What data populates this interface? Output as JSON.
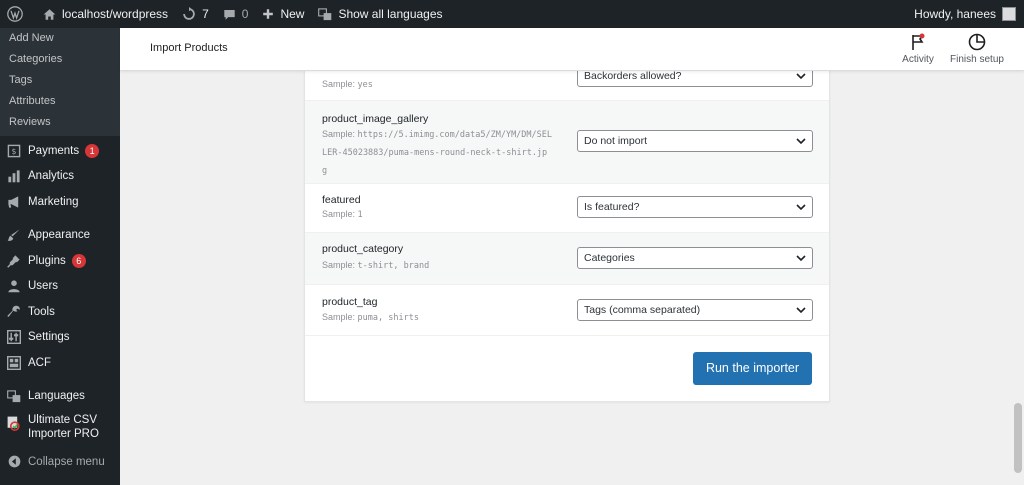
{
  "adminbar": {
    "site": "localhost/wordpress",
    "updates": "7",
    "comments": "0",
    "new": "New",
    "languages": "Show all languages",
    "howdy": "Howdy, hanees"
  },
  "sidebar": {
    "submenu": [
      "Add New",
      "Categories",
      "Tags",
      "Attributes",
      "Reviews"
    ],
    "payments": "Payments",
    "payments_badge": "1",
    "analytics": "Analytics",
    "marketing": "Marketing",
    "appearance": "Appearance",
    "plugins": "Plugins",
    "plugins_badge": "6",
    "users": "Users",
    "tools": "Tools",
    "settings": "Settings",
    "acf": "ACF",
    "languages": "Languages",
    "csv_line1": "Ultimate CSV",
    "csv_line2": "Importer PRO",
    "collapse": "Collapse menu"
  },
  "header": {
    "title": "Import Products",
    "activity": "Activity",
    "finish_setup": "Finish setup"
  },
  "rows": [
    {
      "field": "",
      "sample_label": "Sample:",
      "sample": "yes",
      "select": "Backorders allowed?"
    },
    {
      "field": "product_image_gallery",
      "sample_label": "Sample:",
      "sample": "https://5.imimg.com/data5/ZM/YM/DM/SELLER-45023883/puma-mens-round-neck-t-shirt.jpg",
      "select": "Do not import"
    },
    {
      "field": "featured",
      "sample_label": "Sample:",
      "sample": "1",
      "select": "Is featured?"
    },
    {
      "field": "product_category",
      "sample_label": "Sample:",
      "sample": "t-shirt, brand",
      "select": "Categories"
    },
    {
      "field": "product_tag",
      "sample_label": "Sample:",
      "sample": "puma, shirts",
      "select": "Tags (comma separated)"
    }
  ],
  "run_button": "Run the importer"
}
